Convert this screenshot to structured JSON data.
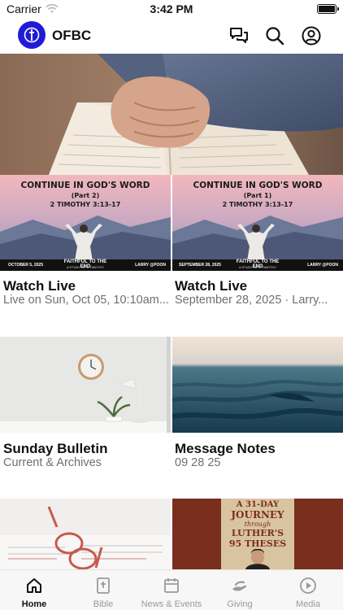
{
  "status_bar": {
    "carrier": "Carrier",
    "time": "3:42 PM"
  },
  "header": {
    "brand": "OFBC"
  },
  "tiles": [
    {
      "title": "Watch Live",
      "subtitle": "Live on Sun, Oct 05, 10:10am...",
      "thumb": {
        "heading": "CONTINUE IN GOD'S WORD",
        "part": "(Part 2)",
        "scripture": "2 TIMOTHY 3:13-17",
        "date": "OCTOBER 5, 2025",
        "series": "FAITHFUL TO THE END",
        "series_sub": "A STUDY OF 2 TIMOTHY",
        "speaker": "LARRY @POON"
      }
    },
    {
      "title": "Watch Live",
      "subtitle": "September 28, 2025 · Larry...",
      "thumb": {
        "heading": "CONTINUE IN GOD'S WORD",
        "part": "(Part 1)",
        "scripture": "2 TIMOTHY 3:13-17",
        "date": "SEPTEMBER 28, 2025",
        "series": "FAITHFUL TO THE END",
        "series_sub": "A STUDY OF 2 TIMOTHY",
        "speaker": "LARRY @POON"
      }
    },
    {
      "title": "Sunday Bulletin",
      "subtitle": "Current & Archives"
    },
    {
      "title": "Message Notes",
      "subtitle": "09 28 25"
    }
  ],
  "book_cover": {
    "line1": "A 31-DAY",
    "line2": "JOURNEY",
    "line3": "through",
    "line4": "LUTHER'S",
    "line5": "95 THESES"
  },
  "tabbar": {
    "items": [
      {
        "label": "Home",
        "icon": "home-icon"
      },
      {
        "label": "Bible",
        "icon": "bible-icon"
      },
      {
        "label": "News & Events",
        "icon": "calendar-icon"
      },
      {
        "label": "Giving",
        "icon": "giving-hand-icon"
      },
      {
        "label": "Media",
        "icon": "play-circle-icon"
      }
    ],
    "active_color": "#111111",
    "inactive_color": "#9a9a9a"
  },
  "colors": {
    "brand": "#1f1bd8"
  }
}
